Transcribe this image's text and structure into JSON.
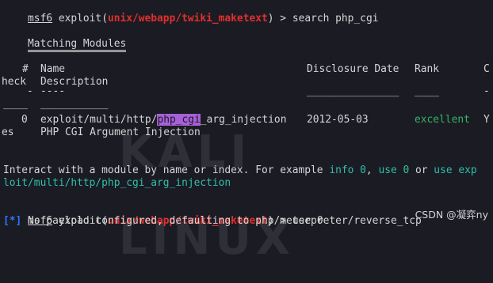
{
  "prompt": {
    "name": "msf6",
    "cmd": "exploit",
    "module": "unix/webapp/twiki_maketext",
    "symbol": ">"
  },
  "search_cmd": "search php_cgi",
  "matching_title": "Matching Modules",
  "table": {
    "col_num": "#",
    "col_name": "Name",
    "col_disclosure": "Disclosure Date",
    "col_rank": "Rank",
    "col_check_a": "C",
    "col_check_b": "heck",
    "col_desc": "Description",
    "dash_num": "-",
    "dash_name": "----",
    "dash_disclosure": "_______________",
    "dash_rank": "____",
    "dash_check": "-",
    "dash_check_b": "____",
    "dash_desc": "___________",
    "row": {
      "num": "0",
      "name_pre": "exploit/multi/http/",
      "name_hl": "php_cgi",
      "name_post": "_arg_injection",
      "date": "2012-05-03",
      "rank": "excellent",
      "check_a": "Y",
      "check_b": "es",
      "desc": "PHP CGI Argument Injection"
    }
  },
  "interact": {
    "prefix": "Interact with a module by name or index. For example ",
    "info": "info 0",
    "sep1": ", ",
    "use0": "use 0",
    "sep2": " or ",
    "use_pre": "use exp",
    "use_cont": "loit/multi/http/php_cgi_arg_injection"
  },
  "use_cmd": "use 0",
  "payload_line": {
    "tag": "[*]",
    "text": " No payload configured, defaulting to php/meterpreter/reverse_tcp"
  },
  "watermark_text": "KALI LINUX",
  "credit": "CSDN @凝弈ny"
}
